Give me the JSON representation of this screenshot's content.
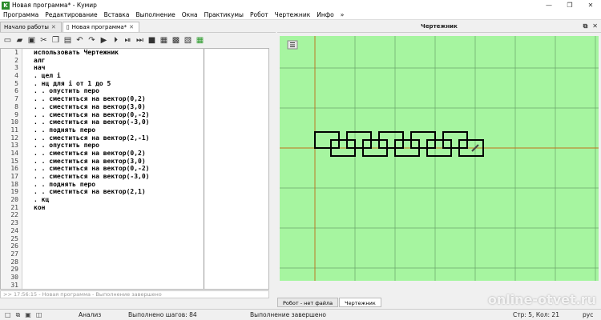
{
  "window": {
    "title": "Новая программа* - Кумир",
    "app_icon": "K",
    "controls": [
      "—",
      "❐",
      "✕"
    ]
  },
  "menu": [
    "Программа",
    "Редактирование",
    "Вставка",
    "Выполнение",
    "Окна",
    "Практикумы",
    "Робот",
    "Чертежник",
    "Инфо",
    "»"
  ],
  "tabs": [
    {
      "label": "Начало работы",
      "active": false
    },
    {
      "label": "Новая программа*",
      "active": true
    }
  ],
  "code_lines": [
    "использовать Чертежник",
    "алг",
    "нач",
    ". цел i",
    ". нц для i от 1 до 5",
    ". . опустить перо",
    ". . сместиться на вектор(0,2)",
    ". . сместиться на вектор(3,0)",
    ". . сместиться на вектор(0,-2)",
    ". . сместиться на вектор(-3,0)",
    ". . поднять перо",
    ". . сместиться на вектор(2,-1)",
    ". . опустить перо",
    ". . сместиться на вектор(0,2)",
    ". . сместиться на вектор(3,0)",
    ". . сместиться на вектор(0,-2)",
    ". . сместиться на вектор(-3,0)",
    ". . поднять перо",
    ". . сместиться на вектор(2,1)",
    ". кц",
    "кон",
    "",
    "",
    "",
    "",
    "",
    "",
    "",
    "",
    "",
    ""
  ],
  "console_text": ">> 17:56:15 - Новая программа - Выполнение завершено",
  "drawer": {
    "title": "Чертежник",
    "bottom_tabs": [
      "Робот - нет файла",
      "Чертежник"
    ],
    "background": "#a6f5a0",
    "grid_color": "#6aa56a"
  },
  "status": {
    "mode": "Анализ",
    "steps": "Выполнено шагов: 84",
    "state": "Выполнение завершено",
    "position": "Стр: 5, Кол: 21",
    "lang": "рус"
  },
  "watermark": "online-otvet.ru"
}
